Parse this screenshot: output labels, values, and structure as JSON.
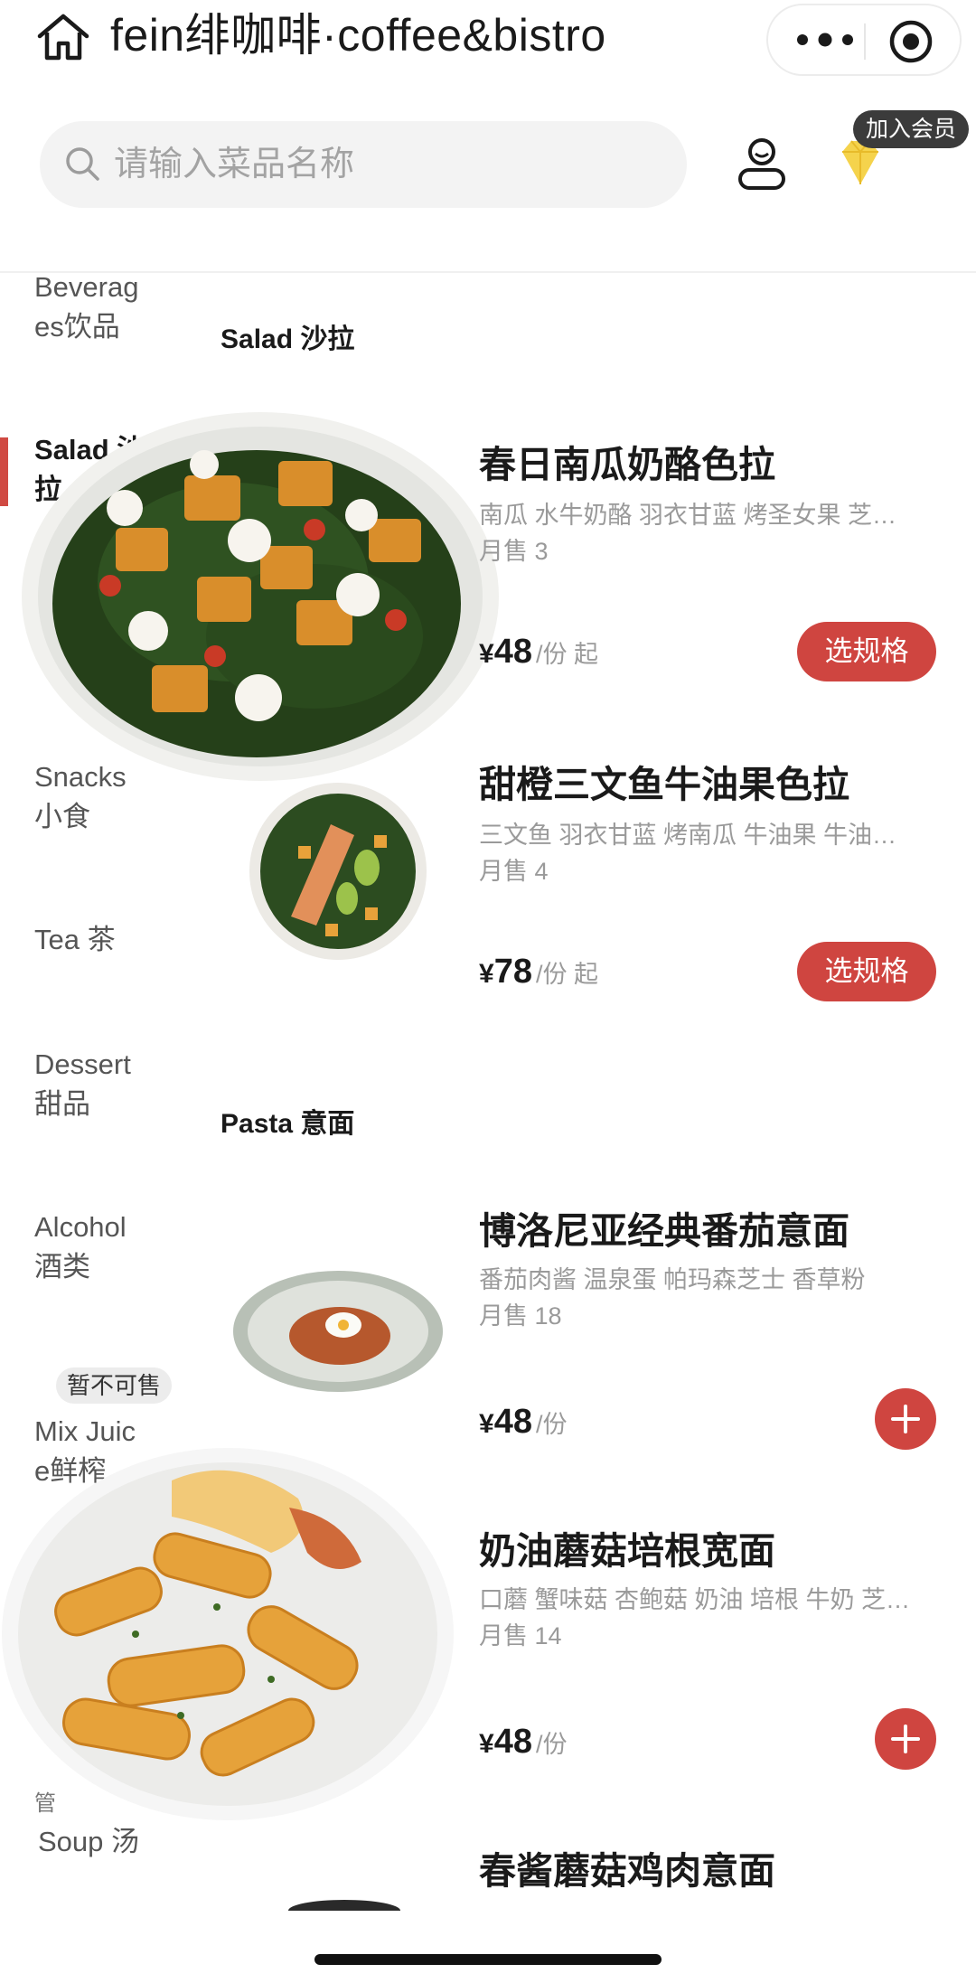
{
  "nav": {
    "title": "fein绯咖啡·coffee&bistro"
  },
  "search": {
    "placeholder": "请输入菜品名称"
  },
  "member": {
    "join_label": "加入会员"
  },
  "categories": [
    {
      "label": "Beverag\nes饮品",
      "active": false
    },
    {
      "label": "Salad 沙\n拉",
      "active": true
    },
    {
      "label": "Snacks\n小食",
      "active": false
    },
    {
      "label": "Tea 茶",
      "active": false
    },
    {
      "label": "Dessert\n甜品",
      "active": false
    },
    {
      "label": "Alcohol\n酒类",
      "active": false
    },
    {
      "label": "Mix Juic\ne鲜榨",
      "active": false
    },
    {
      "label": "Soup 汤",
      "active": false
    }
  ],
  "sold_out_badge": "暂不可售",
  "partial_category_glyph": "管",
  "sections": {
    "salad": "Salad 沙拉",
    "pasta": "Pasta 意面"
  },
  "dishes": [
    {
      "name": "春日南瓜奶酪色拉",
      "desc": "南瓜 水牛奶酪 羽衣甘蓝 烤圣女果 芝…",
      "sales": "月售 3",
      "currency": "¥",
      "price": "48",
      "unit": "/份 起",
      "action": "选规格"
    },
    {
      "name": "甜橙三文鱼牛油果色拉",
      "desc": "三文鱼 羽衣甘蓝 烤南瓜 牛油果 牛油…",
      "sales": "月售 4",
      "currency": "¥",
      "price": "78",
      "unit": "/份 起",
      "action": "选规格"
    },
    {
      "name": "博洛尼亚经典番茄意面",
      "desc": "番茄肉酱 温泉蛋 帕玛森芝士 香草粉",
      "sales": "月售 18",
      "currency": "¥",
      "price": "48",
      "unit": "/份",
      "action": "+"
    },
    {
      "name": "奶油蘑菇培根宽面",
      "desc": "口蘑 蟹味菇 杏鲍菇 奶油 培根 牛奶 芝…",
      "sales": "月售 14",
      "currency": "¥",
      "price": "48",
      "unit": "/份",
      "action": "+"
    },
    {
      "name": "春酱蘑菇鸡肉意面",
      "desc": "",
      "sales": "",
      "currency": "¥",
      "price": "",
      "unit": "",
      "action": ""
    }
  ],
  "colors": {
    "accent": "#cf4540",
    "member_tag_bg": "#3b3b3b",
    "diamond": "#f5d34c"
  }
}
